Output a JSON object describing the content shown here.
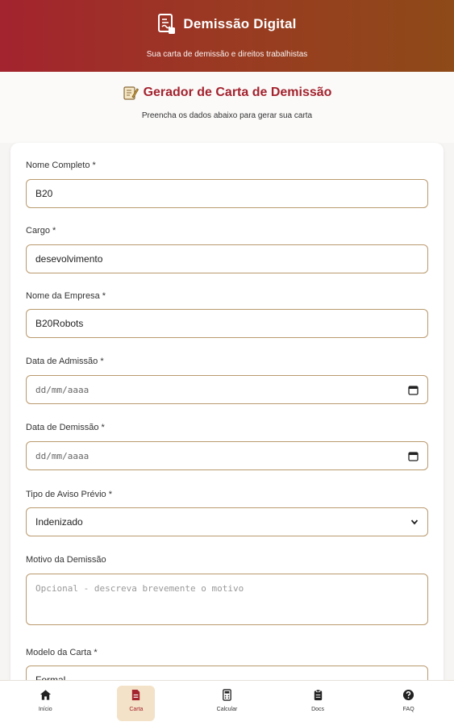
{
  "header": {
    "title": "Demissão Digital",
    "subtitle": "Sua carta de demissão e direitos trabalhistas",
    "icon": "document-signature-icon"
  },
  "hero": {
    "title": "Gerador de Carta de Demissão",
    "hint": "Preencha os dados abaixo para gerar sua carta",
    "icon": "memo-icon"
  },
  "form": {
    "nome_label": "Nome Completo *",
    "nome_value": "B20",
    "cargo_label": "Cargo *",
    "cargo_value": "desevolvimento",
    "empresa_label": "Nome da Empresa *",
    "empresa_value": "B20Robots",
    "admissao_label": "Data de Admissão *",
    "admissao_placeholder": "dd/mm/aaaa",
    "demissao_label": "Data de Demissão *",
    "demissao_placeholder": "dd/mm/aaaa",
    "aviso_label": "Tipo de Aviso Prévio *",
    "aviso_value": "Indenizado",
    "motivo_label": "Motivo da Demissão",
    "motivo_placeholder": "Opcional - descreva brevemente o motivo",
    "modelo_label": "Modelo da Carta *",
    "modelo_value": "Formal"
  },
  "nav": {
    "inicio": "Início",
    "carta": "Carta",
    "calcular": "Calcular",
    "docs": "Docs",
    "faq": "FAQ",
    "active": "carta"
  },
  "colors": {
    "accent": "#a3232e",
    "border": "#b99a6e",
    "active_bg": "#f3e2c7"
  }
}
